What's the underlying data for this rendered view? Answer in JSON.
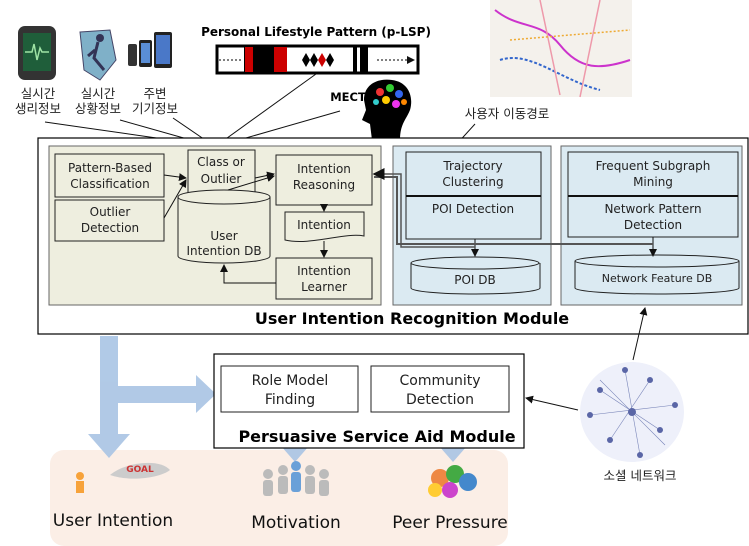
{
  "sources": {
    "physio": [
      "실시간",
      "생리정보"
    ],
    "context": [
      "실시간",
      "상황정보"
    ],
    "devices": [
      "주변",
      "기기정보"
    ],
    "plsp_title": "Personal  Lifestyle Pattern (p-LSP)",
    "mect": "MECT",
    "trajectory_label": "사용자 이동경로",
    "social_label": "소셜 네트워크"
  },
  "recognition_module": {
    "title": "User Intention Recognition Module",
    "pattern_based": [
      "Pattern-Based",
      "Classification"
    ],
    "outlier_detection": [
      "Outlier",
      "Detection"
    ],
    "class_or_outlier": [
      "Class or",
      "Outlier"
    ],
    "intention_reasoning": [
      "Intention",
      "Reasoning"
    ],
    "intention": "Intention",
    "intention_learner": [
      "Intention",
      "Learner"
    ],
    "user_intention_db": [
      "User",
      "Intention DB"
    ],
    "trajectory_clustering": [
      "Trajectory",
      "Clustering"
    ],
    "poi_detection": "POI Detection",
    "poi_db": "POI DB",
    "frequent_subgraph": [
      "Frequent Subgraph",
      "Mining"
    ],
    "network_pattern": [
      "Network Pattern",
      "Detection"
    ],
    "network_feature_db": "Network Feature DB"
  },
  "persuasive_module": {
    "title": "Persuasive Service Aid Module",
    "role_model": [
      "Role Model",
      "Finding"
    ],
    "community": [
      "Community",
      "Detection"
    ]
  },
  "outcomes": {
    "goal": "GOAL",
    "user_intention": "User Intention",
    "motivation": "Motivation",
    "peer_pressure": "Peer Pressure"
  },
  "colors": {
    "green_panel": "#eeeedf",
    "blue_panel": "#dbeaf2",
    "arrow_blue": "#a9c4e4",
    "outcome_bg": "#fbeee6"
  }
}
